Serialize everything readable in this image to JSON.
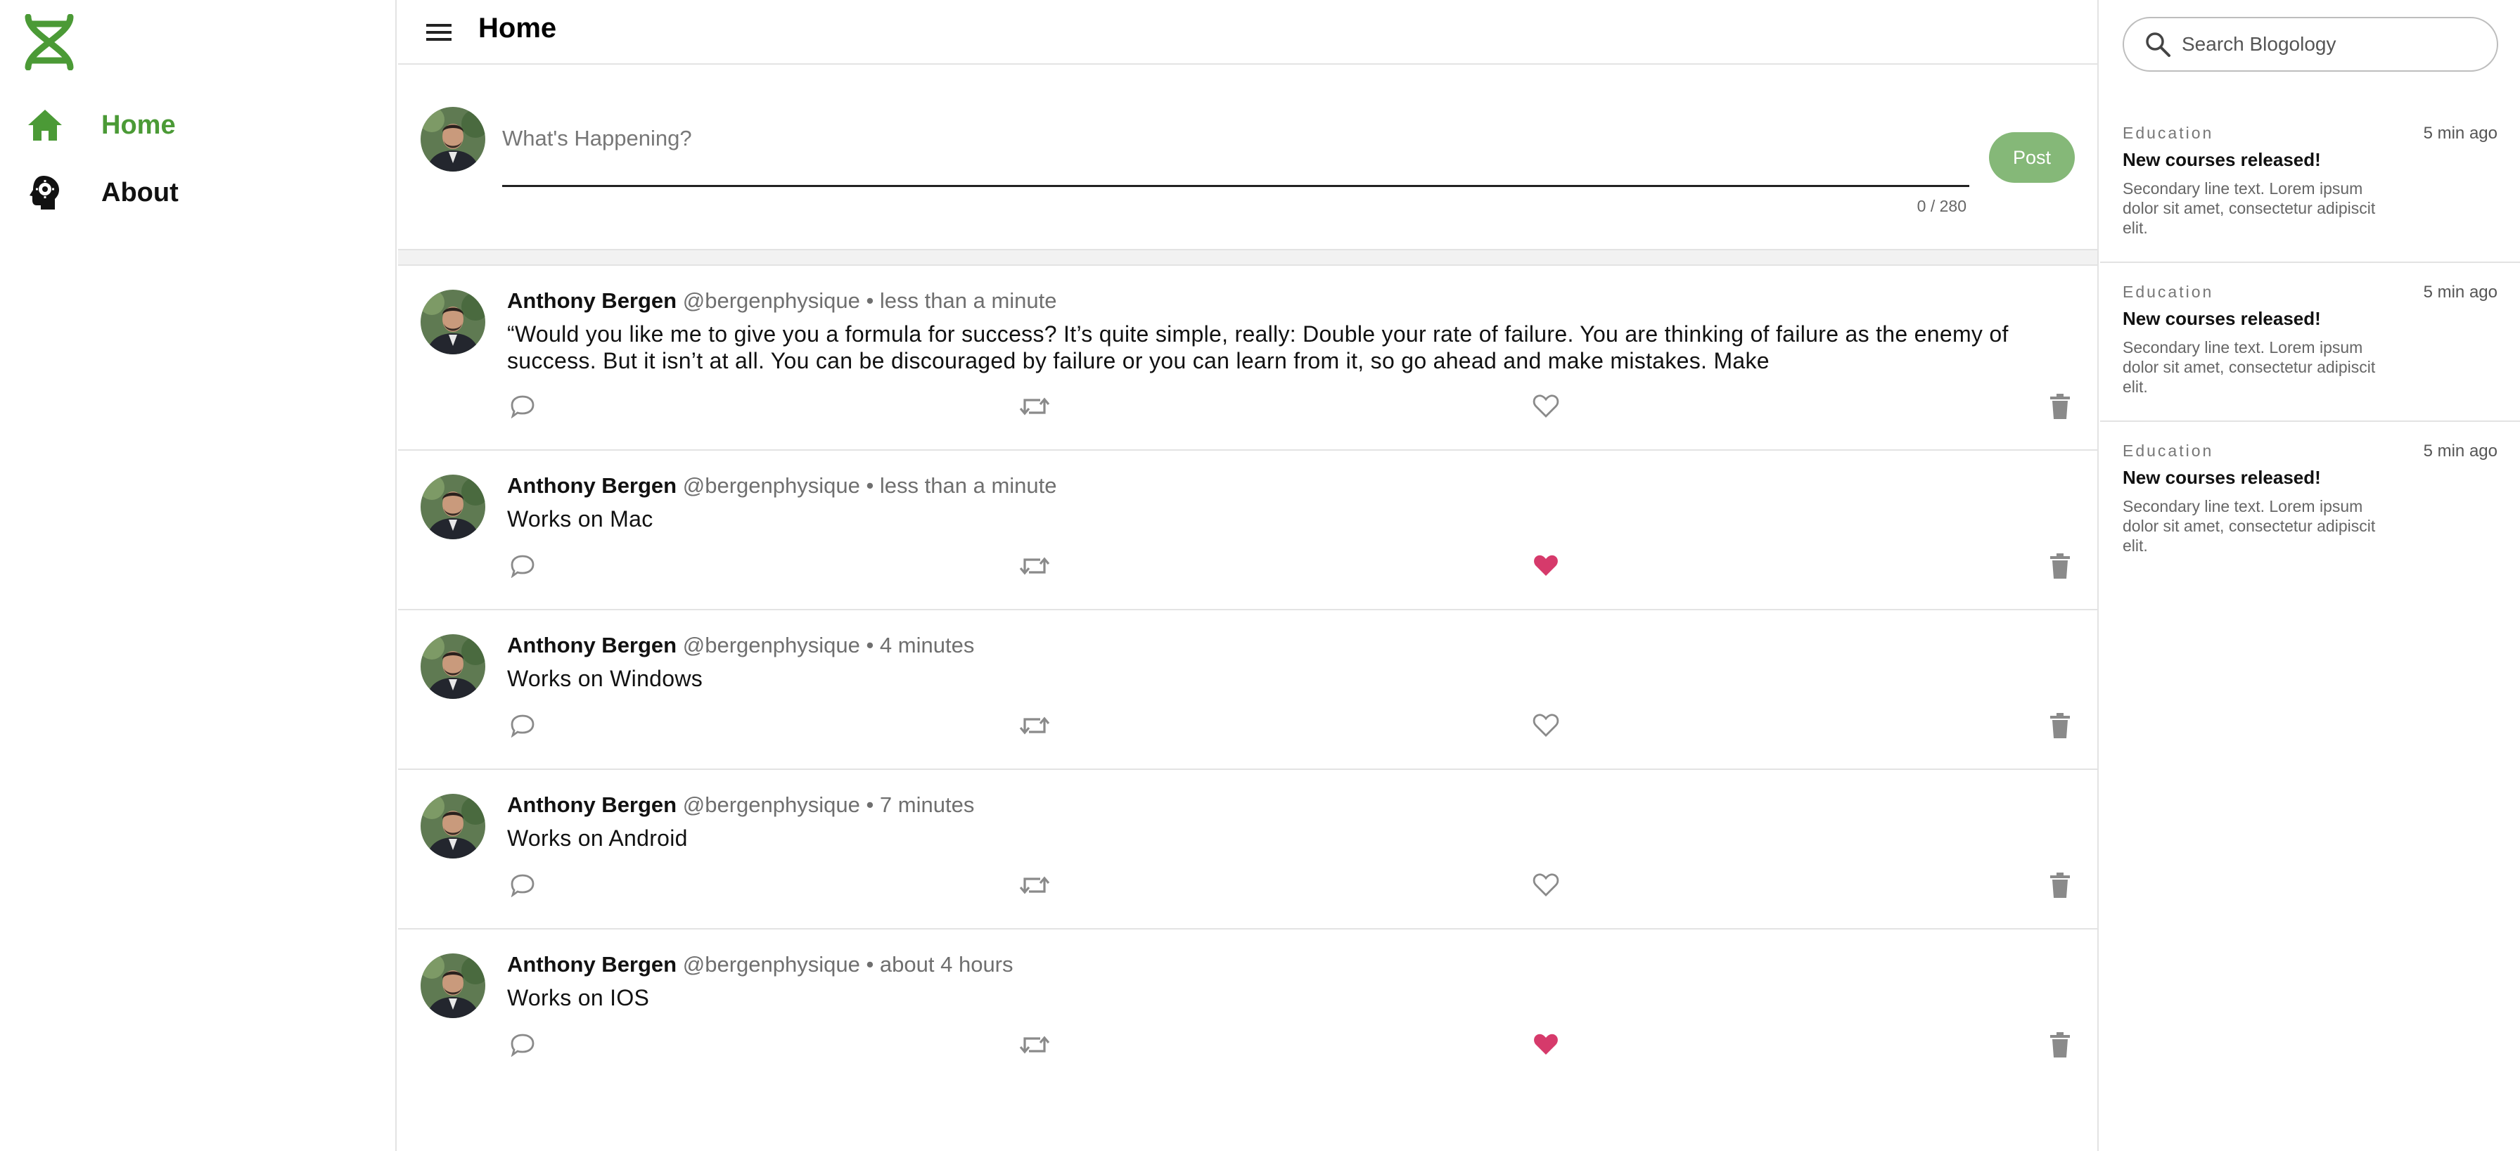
{
  "nav": {
    "items": [
      {
        "label": "Home",
        "icon": "home-icon"
      },
      {
        "label": "About",
        "icon": "head-gear-icon"
      }
    ]
  },
  "colors": {
    "brand_green": "#4b9a36",
    "post_button": "#85b878",
    "liked_heart": "#d63a6b",
    "icon_gray": "#8a8a8a"
  },
  "header": {
    "title": "Home"
  },
  "composer": {
    "placeholder": "What's Happening?",
    "char_count": "0 / 280",
    "post_label": "Post"
  },
  "posts": [
    {
      "author": "Anthony Bergen",
      "meta": "@bergenphysique • less than a minute",
      "text": "“Would you like me to give you a formula for success? It’s quite simple, really: Double your rate of failure. You are thinking of failure as the enemy of success. But it isn’t at all. You can be discouraged by failure or you can learn from it, so go ahead and make mistakes. Make",
      "liked": false
    },
    {
      "author": "Anthony Bergen",
      "meta": "@bergenphysique • less than a minute",
      "text": "Works on Mac",
      "liked": true
    },
    {
      "author": "Anthony Bergen",
      "meta": "@bergenphysique • 4 minutes",
      "text": "Works on Windows",
      "liked": false
    },
    {
      "author": "Anthony Bergen",
      "meta": "@bergenphysique • 7 minutes",
      "text": "Works on Android",
      "liked": false
    },
    {
      "author": "Anthony Bergen",
      "meta": "@bergenphysique • about 4 hours",
      "text": "Works on IOS",
      "liked": true
    }
  ],
  "search": {
    "placeholder": "Search Blogology"
  },
  "news": [
    {
      "category": "Education",
      "time": "5 min ago",
      "title": "New courses released!",
      "body": "Secondary line text. Lorem ipsum dolor sit amet, consectetur adipiscit elit."
    },
    {
      "category": "Education",
      "time": "5 min ago",
      "title": "New courses released!",
      "body": "Secondary line text. Lorem ipsum dolor sit amet, consectetur adipiscit elit."
    },
    {
      "category": "Education",
      "time": "5 min ago",
      "title": "New courses released!",
      "body": "Secondary line text. Lorem ipsum dolor sit amet, consectetur adipiscit elit."
    }
  ]
}
